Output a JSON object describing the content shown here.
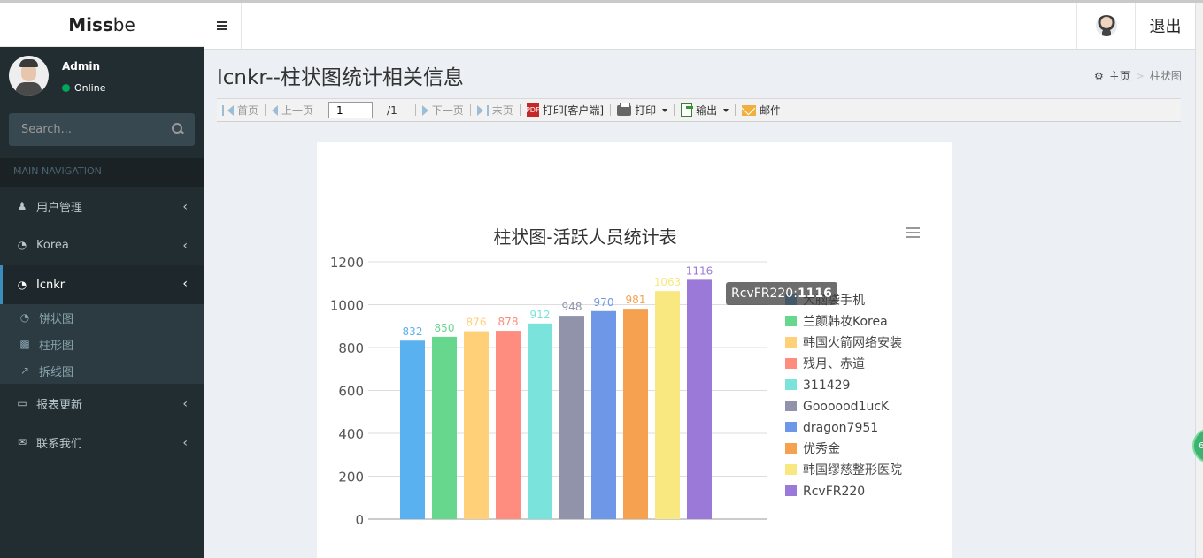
{
  "app": {
    "logo_bold": "Miss",
    "logo_rest": "be"
  },
  "header": {
    "logout": "退出"
  },
  "user": {
    "name": "Admin",
    "status": "Online"
  },
  "search": {
    "placeholder": "Search..."
  },
  "sidebar": {
    "section_header": "MAIN NAVIGATION",
    "items": [
      {
        "label": "用户管理",
        "icon": "user-icon"
      },
      {
        "label": "Korea",
        "icon": "pie-icon"
      },
      {
        "label": "Icnkr",
        "icon": "pie-icon"
      },
      {
        "label": "报表更新",
        "icon": "laptop-icon"
      },
      {
        "label": "联系我们",
        "icon": "envelope-icon"
      }
    ],
    "subitems": [
      {
        "label": "饼状图",
        "icon": "pie-icon"
      },
      {
        "label": "柱形图",
        "icon": "bar-chart-icon"
      },
      {
        "label": "拆线图",
        "icon": "line-chart-icon"
      }
    ]
  },
  "page": {
    "title": "Icnkr--柱状图统计相关信息",
    "breadcrumb": {
      "home": "主页",
      "current": "柱状图"
    }
  },
  "toolbar": {
    "first": "首页",
    "prev": "上一页",
    "page_value": "1",
    "page_total": "/1",
    "next": "下一页",
    "last": "末页",
    "print_client": "打印[客户端]",
    "print": "打印",
    "export": "输出",
    "mail": "邮件"
  },
  "tooltip": {
    "name": "RcvFR220",
    "value": "1116"
  },
  "chart_data": {
    "type": "bar",
    "title": "柱状图-活跃人员统计表",
    "categories": [
      "大脑袋手机",
      "兰颜韩妆Korea",
      "韩国火箭网络安装",
      "残月、赤道",
      "311429",
      "Goooood1ucK",
      "dragon7951",
      "优秀金",
      "韩国缪慈整形医院",
      "RcvFR220"
    ],
    "values": [
      832,
      850,
      876,
      878,
      912,
      948,
      970,
      981,
      1063,
      1116
    ],
    "colors": [
      "#5ab1ef",
      "#66d78d",
      "#ffd078",
      "#fe8c7f",
      "#7ae4dc",
      "#9193ab",
      "#6f97e8",
      "#f6a14f",
      "#f9e780",
      "#9b79d8"
    ],
    "ylim": [
      0,
      1200
    ],
    "yticks": [
      0,
      200,
      400,
      600,
      800,
      1000,
      1200
    ],
    "legend_position": "right",
    "grid": true
  }
}
